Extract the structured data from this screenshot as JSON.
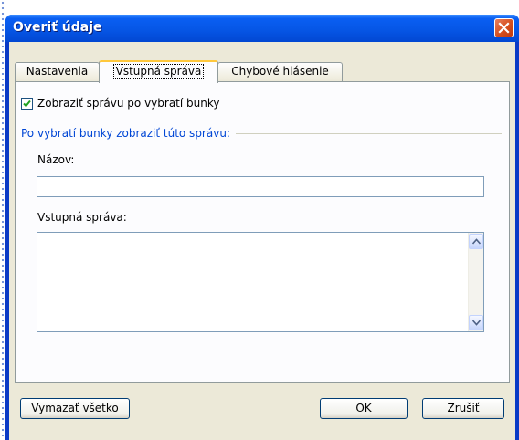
{
  "dialog": {
    "title": "Overiť údaje",
    "close_icon": "close-icon"
  },
  "tabs": [
    {
      "label": "Nastavenia",
      "active": false
    },
    {
      "label": "Vstupná správa",
      "active": true
    },
    {
      "label": "Chybové hlásenie",
      "active": false
    }
  ],
  "input_message": {
    "show_checkbox": {
      "label": "Zobraziť správu po vybratí bunky",
      "checked": true
    },
    "group_label": "Po vybratí bunky zobraziť túto správu:",
    "title_label": "Názov:",
    "title_value": "",
    "message_label": "Vstupná správa:",
    "message_value": ""
  },
  "buttons": {
    "clear_all": "Vymazať všetko",
    "ok": "OK",
    "cancel": "Zrušiť"
  },
  "colors": {
    "titlebar": "#0a5ff2",
    "dialog_bg": "#ece9d8",
    "group_label": "#0046d5",
    "close_button": "#d64f1e"
  }
}
